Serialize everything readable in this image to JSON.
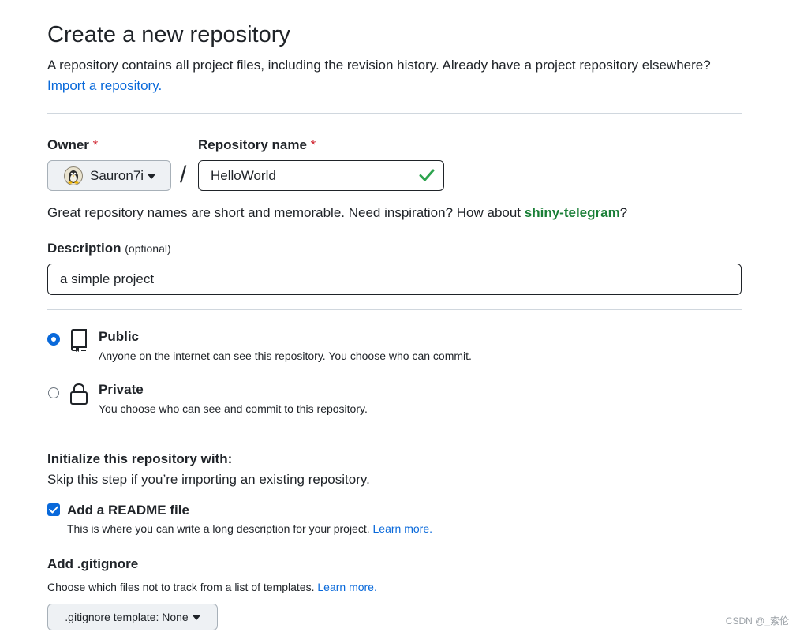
{
  "header": {
    "title": "Create a new repository",
    "subtitle": "A repository contains all project files, including the revision history. Already have a project repository elsewhere?",
    "import_link": "Import a repository."
  },
  "owner": {
    "label": "Owner",
    "required_mark": "*",
    "value": "Sauron7i"
  },
  "separator": "/",
  "repository_name": {
    "label": "Repository name",
    "required_mark": "*",
    "value": "HelloWorld",
    "valid": true
  },
  "name_hint": {
    "text": "Great repository names are short and memorable. Need inspiration? How about",
    "suggestion": "shiny-telegram",
    "suffix": "?"
  },
  "description": {
    "label": "Description",
    "optional": "(optional)",
    "value": "a simple project"
  },
  "visibility": {
    "selected": "public",
    "public": {
      "title": "Public",
      "desc": "Anyone on the internet can see this repository. You choose who can commit."
    },
    "private": {
      "title": "Private",
      "desc": "You choose who can see and commit to this repository."
    }
  },
  "initialize": {
    "heading": "Initialize this repository with:",
    "subtext": "Skip this step if you’re importing an existing repository.",
    "readme": {
      "label": "Add a README file",
      "checked": true,
      "desc": "This is where you can write a long description for your project.",
      "learn_more": "Learn more."
    }
  },
  "gitignore": {
    "heading": "Add .gitignore",
    "desc": "Choose which files not to track from a list of templates.",
    "learn_more": "Learn more.",
    "button": ".gitignore template: None"
  },
  "watermark": "CSDN @_索伦",
  "colors": {
    "link": "#0969da",
    "required": "#cf222e",
    "suggestion": "#1a7f37",
    "valid_check": "#2da44e",
    "text": "#1f2328"
  }
}
